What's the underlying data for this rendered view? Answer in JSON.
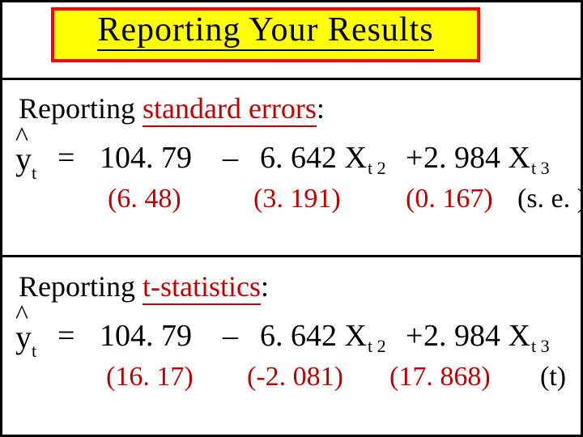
{
  "title": "Reporting  Your  Results",
  "section1": {
    "heading_plain": "Reporting  ",
    "heading_red": "standard errors",
    "colon": ":",
    "eq": {
      "y": "y",
      "ysub": "t",
      "hat": "^",
      "eq": "=",
      "const": "104. 79",
      "minus": "–",
      "b2": "6. 642 X",
      "b2sub": "t 2",
      "plus": "+",
      "b3": "2. 984 X",
      "b3sub": "t 3"
    },
    "parens": {
      "a": "(6. 48)",
      "b": "(3. 191)",
      "c": "(0. 167)",
      "d": "(s. e. )"
    }
  },
  "section2": {
    "heading_plain": "Reporting  ",
    "heading_red": "t-statistics",
    "colon": ":",
    "eq": {
      "y": "y",
      "ysub": "t",
      "hat": "^",
      "eq": "=",
      "const": "104. 79",
      "minus": "–",
      "b2": "6. 642 X",
      "b2sub": "t 2",
      "plus": "+",
      "b3": "2. 984 X",
      "b3sub": "t 3"
    },
    "parens": {
      "a": "(16. 17)",
      "b": "(-2. 081)",
      "c": "(17. 868)",
      "d": "(t)"
    }
  }
}
